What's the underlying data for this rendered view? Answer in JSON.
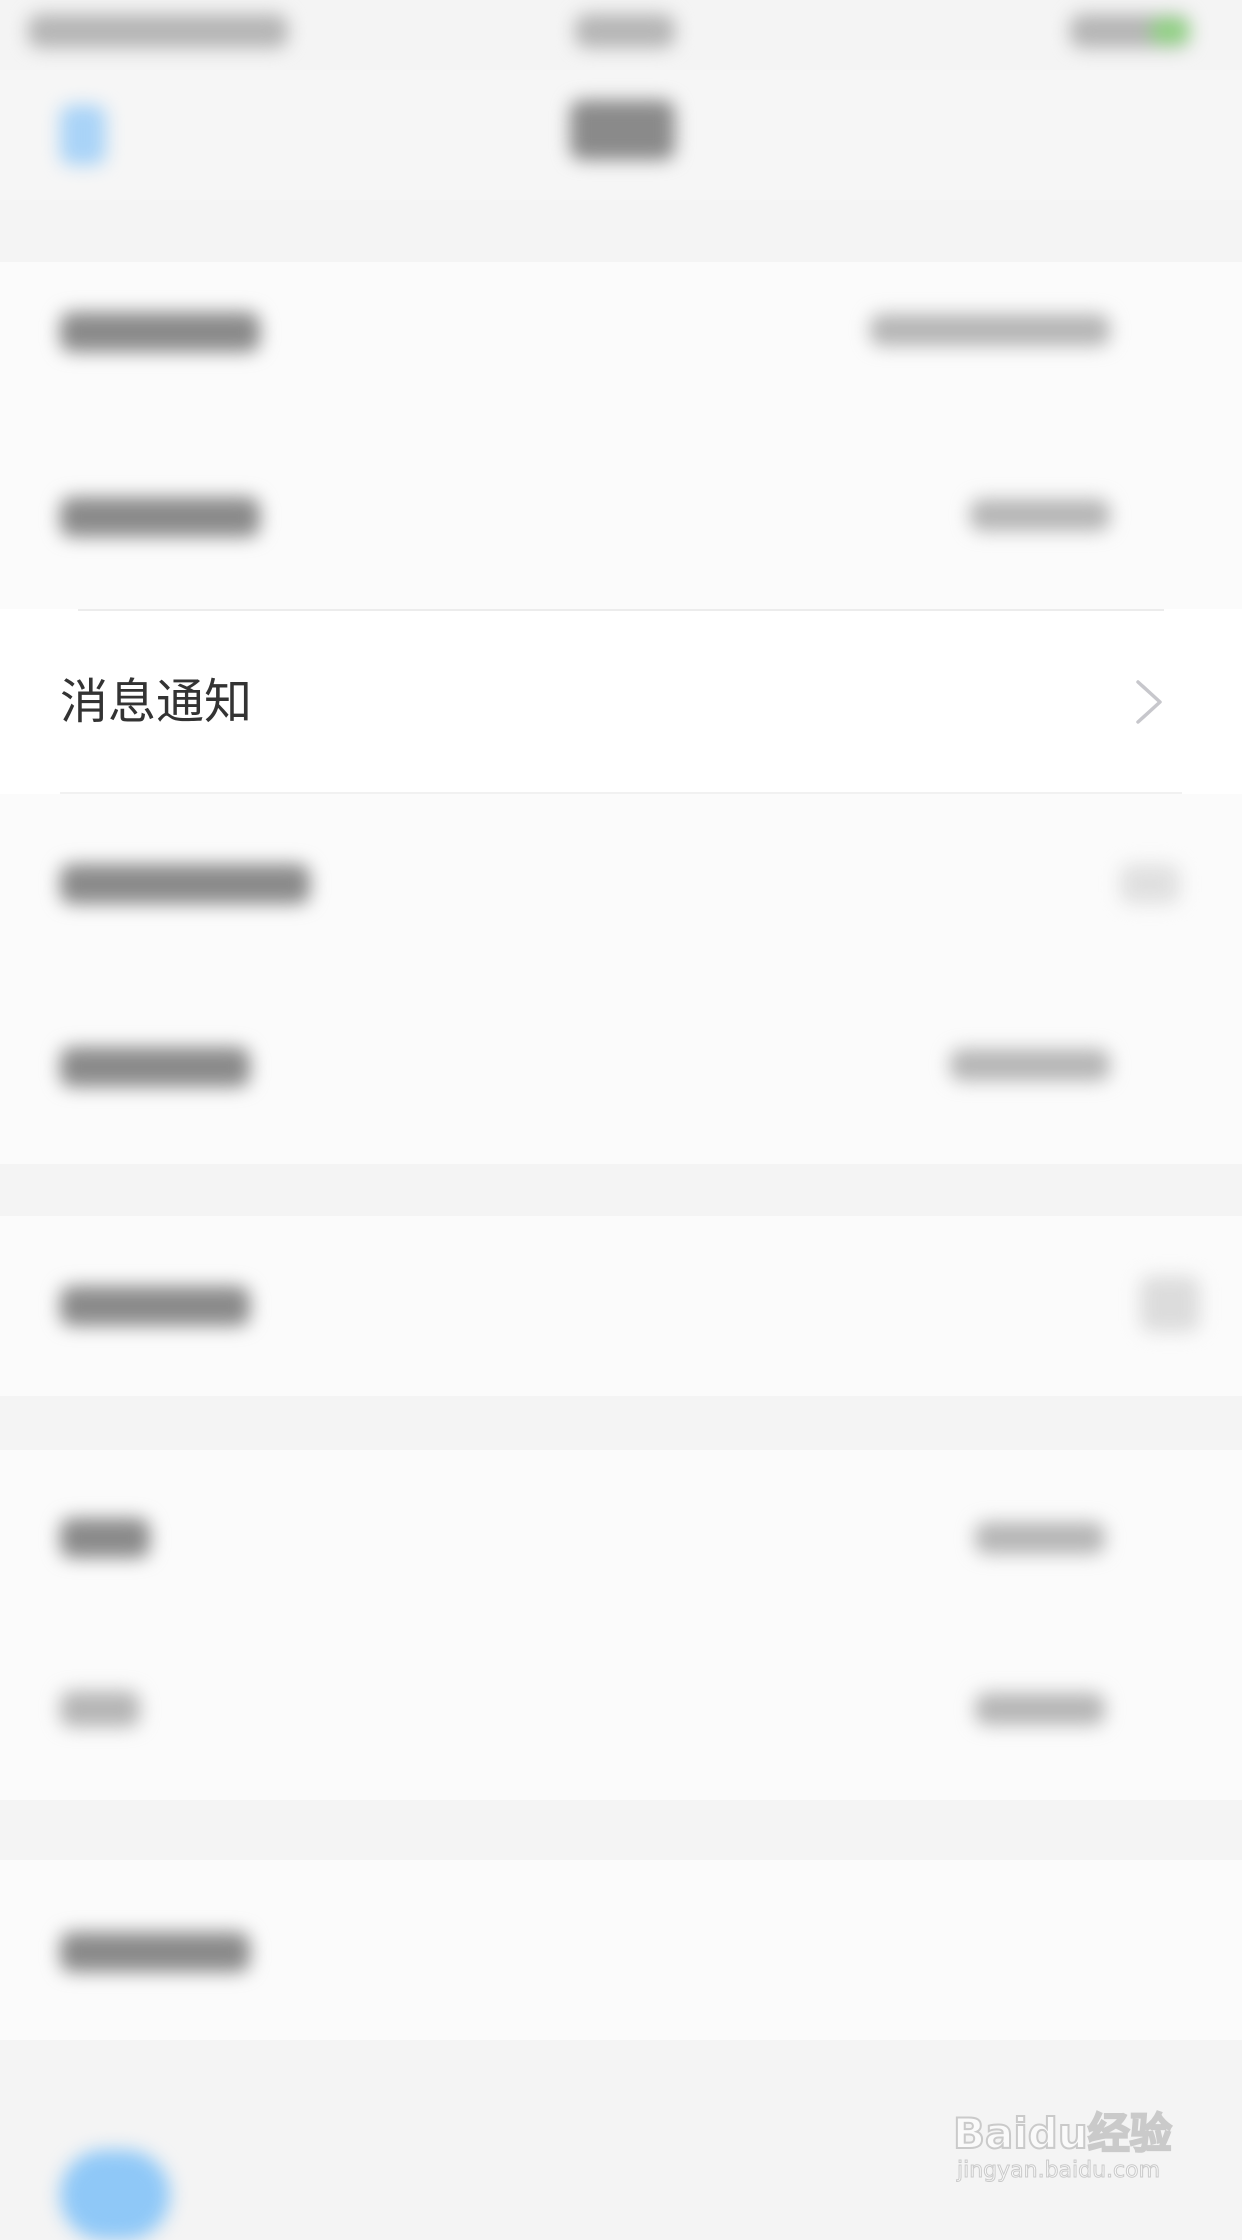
{
  "message_notification": {
    "label": "消息通知"
  },
  "watermark": {
    "logo": "Baidu经验",
    "url": "jingyan.baidu.com"
  },
  "colors": {
    "accent_blue": "#4aa3f0",
    "accent_green": "#5cc24a",
    "label_text": "#333333",
    "background": "#f4f4f4"
  },
  "icons": [
    "chevron-right-icon",
    "back-icon",
    "battery-icon"
  ]
}
